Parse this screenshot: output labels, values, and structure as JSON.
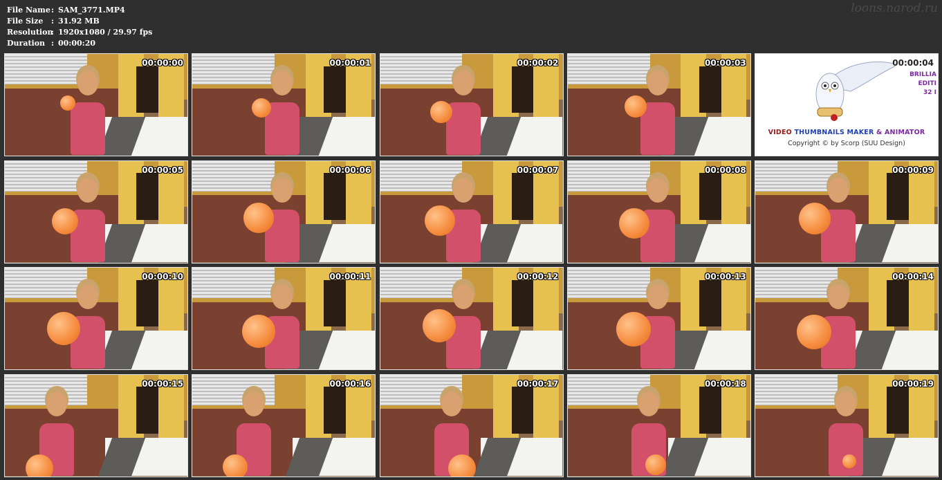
{
  "info": {
    "rows": [
      {
        "label": "File Name",
        "value": "SAM_3771.MP4"
      },
      {
        "label": "File Size",
        "value": "31.92 MB"
      },
      {
        "label": "Resolution",
        "value": "1920x1080 / 29.97 fps"
      },
      {
        "label": "Duration",
        "value": "00:00:20"
      }
    ],
    "colon": ":"
  },
  "watermark": "loons.narod.ru",
  "thumbnails": [
    {
      "timestamp": "00:00:00"
    },
    {
      "timestamp": "00:00:01"
    },
    {
      "timestamp": "00:00:02"
    },
    {
      "timestamp": "00:00:03"
    },
    {
      "timestamp": "00:00:04"
    },
    {
      "timestamp": "00:00:05"
    },
    {
      "timestamp": "00:00:06"
    },
    {
      "timestamp": "00:00:07"
    },
    {
      "timestamp": "00:00:08"
    },
    {
      "timestamp": "00:00:09"
    },
    {
      "timestamp": "00:00:10"
    },
    {
      "timestamp": "00:00:11"
    },
    {
      "timestamp": "00:00:12"
    },
    {
      "timestamp": "00:00:13"
    },
    {
      "timestamp": "00:00:14"
    },
    {
      "timestamp": "00:00:15"
    },
    {
      "timestamp": "00:00:16"
    },
    {
      "timestamp": "00:00:17"
    },
    {
      "timestamp": "00:00:18"
    },
    {
      "timestamp": "00:00:19"
    }
  ],
  "logo": {
    "title_part1": "VIDEO ",
    "title_part2": "THUMBNAILS MAKER ",
    "title_part3": "& ANIMATOR",
    "copyright": "Copyright © by Scorp (SUU Design)",
    "side_line1": "BRILLIA",
    "side_line2": "EDITI",
    "side_line3": "32 I"
  },
  "colors": {
    "background": "#2f2f2f",
    "balloon": "#f58b3d",
    "shirt": "#d2506a",
    "wall_yellow": "#e7c14f"
  }
}
